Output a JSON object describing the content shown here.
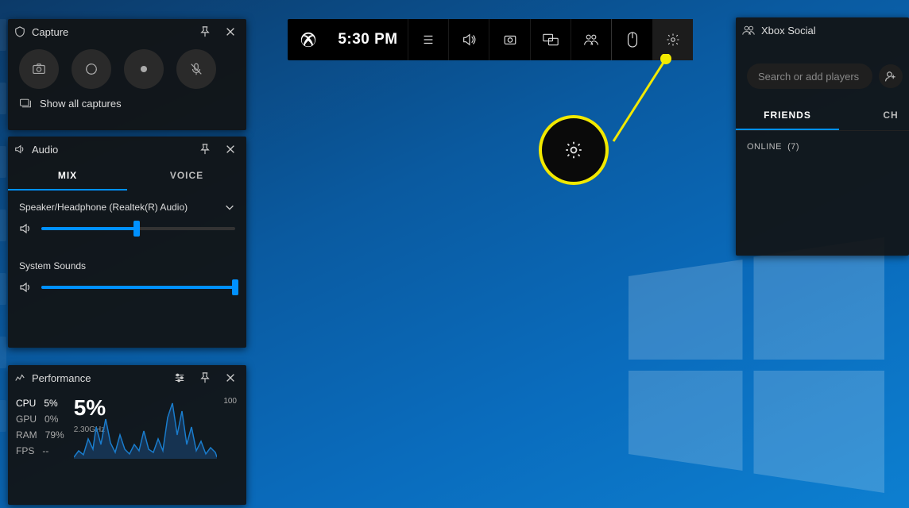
{
  "capture": {
    "title": "Capture",
    "show_all": "Show all captures"
  },
  "audio": {
    "title": "Audio",
    "tabs": {
      "mix": "MIX",
      "voice": "VOICE"
    },
    "device": "Speaker/Headphone (Realtek(R) Audio)",
    "device_volume_pct": 49,
    "system": "System Sounds",
    "system_volume_pct": 100
  },
  "perf": {
    "title": "Performance",
    "stats": [
      {
        "label": "CPU",
        "value": "5%"
      },
      {
        "label": "GPU",
        "value": "0%"
      },
      {
        "label": "RAM",
        "value": "79%"
      },
      {
        "label": "FPS",
        "value": "--"
      }
    ],
    "big": "5%",
    "freq": "2.30GHz",
    "ymax": "100"
  },
  "toolbar": {
    "time": "5:30 PM"
  },
  "social": {
    "title": "Xbox Social",
    "search_placeholder": "Search or add players",
    "tabs": {
      "friends": "FRIENDS",
      "chat": "CH"
    },
    "online_label": "ONLINE",
    "online_count": "(7)"
  }
}
